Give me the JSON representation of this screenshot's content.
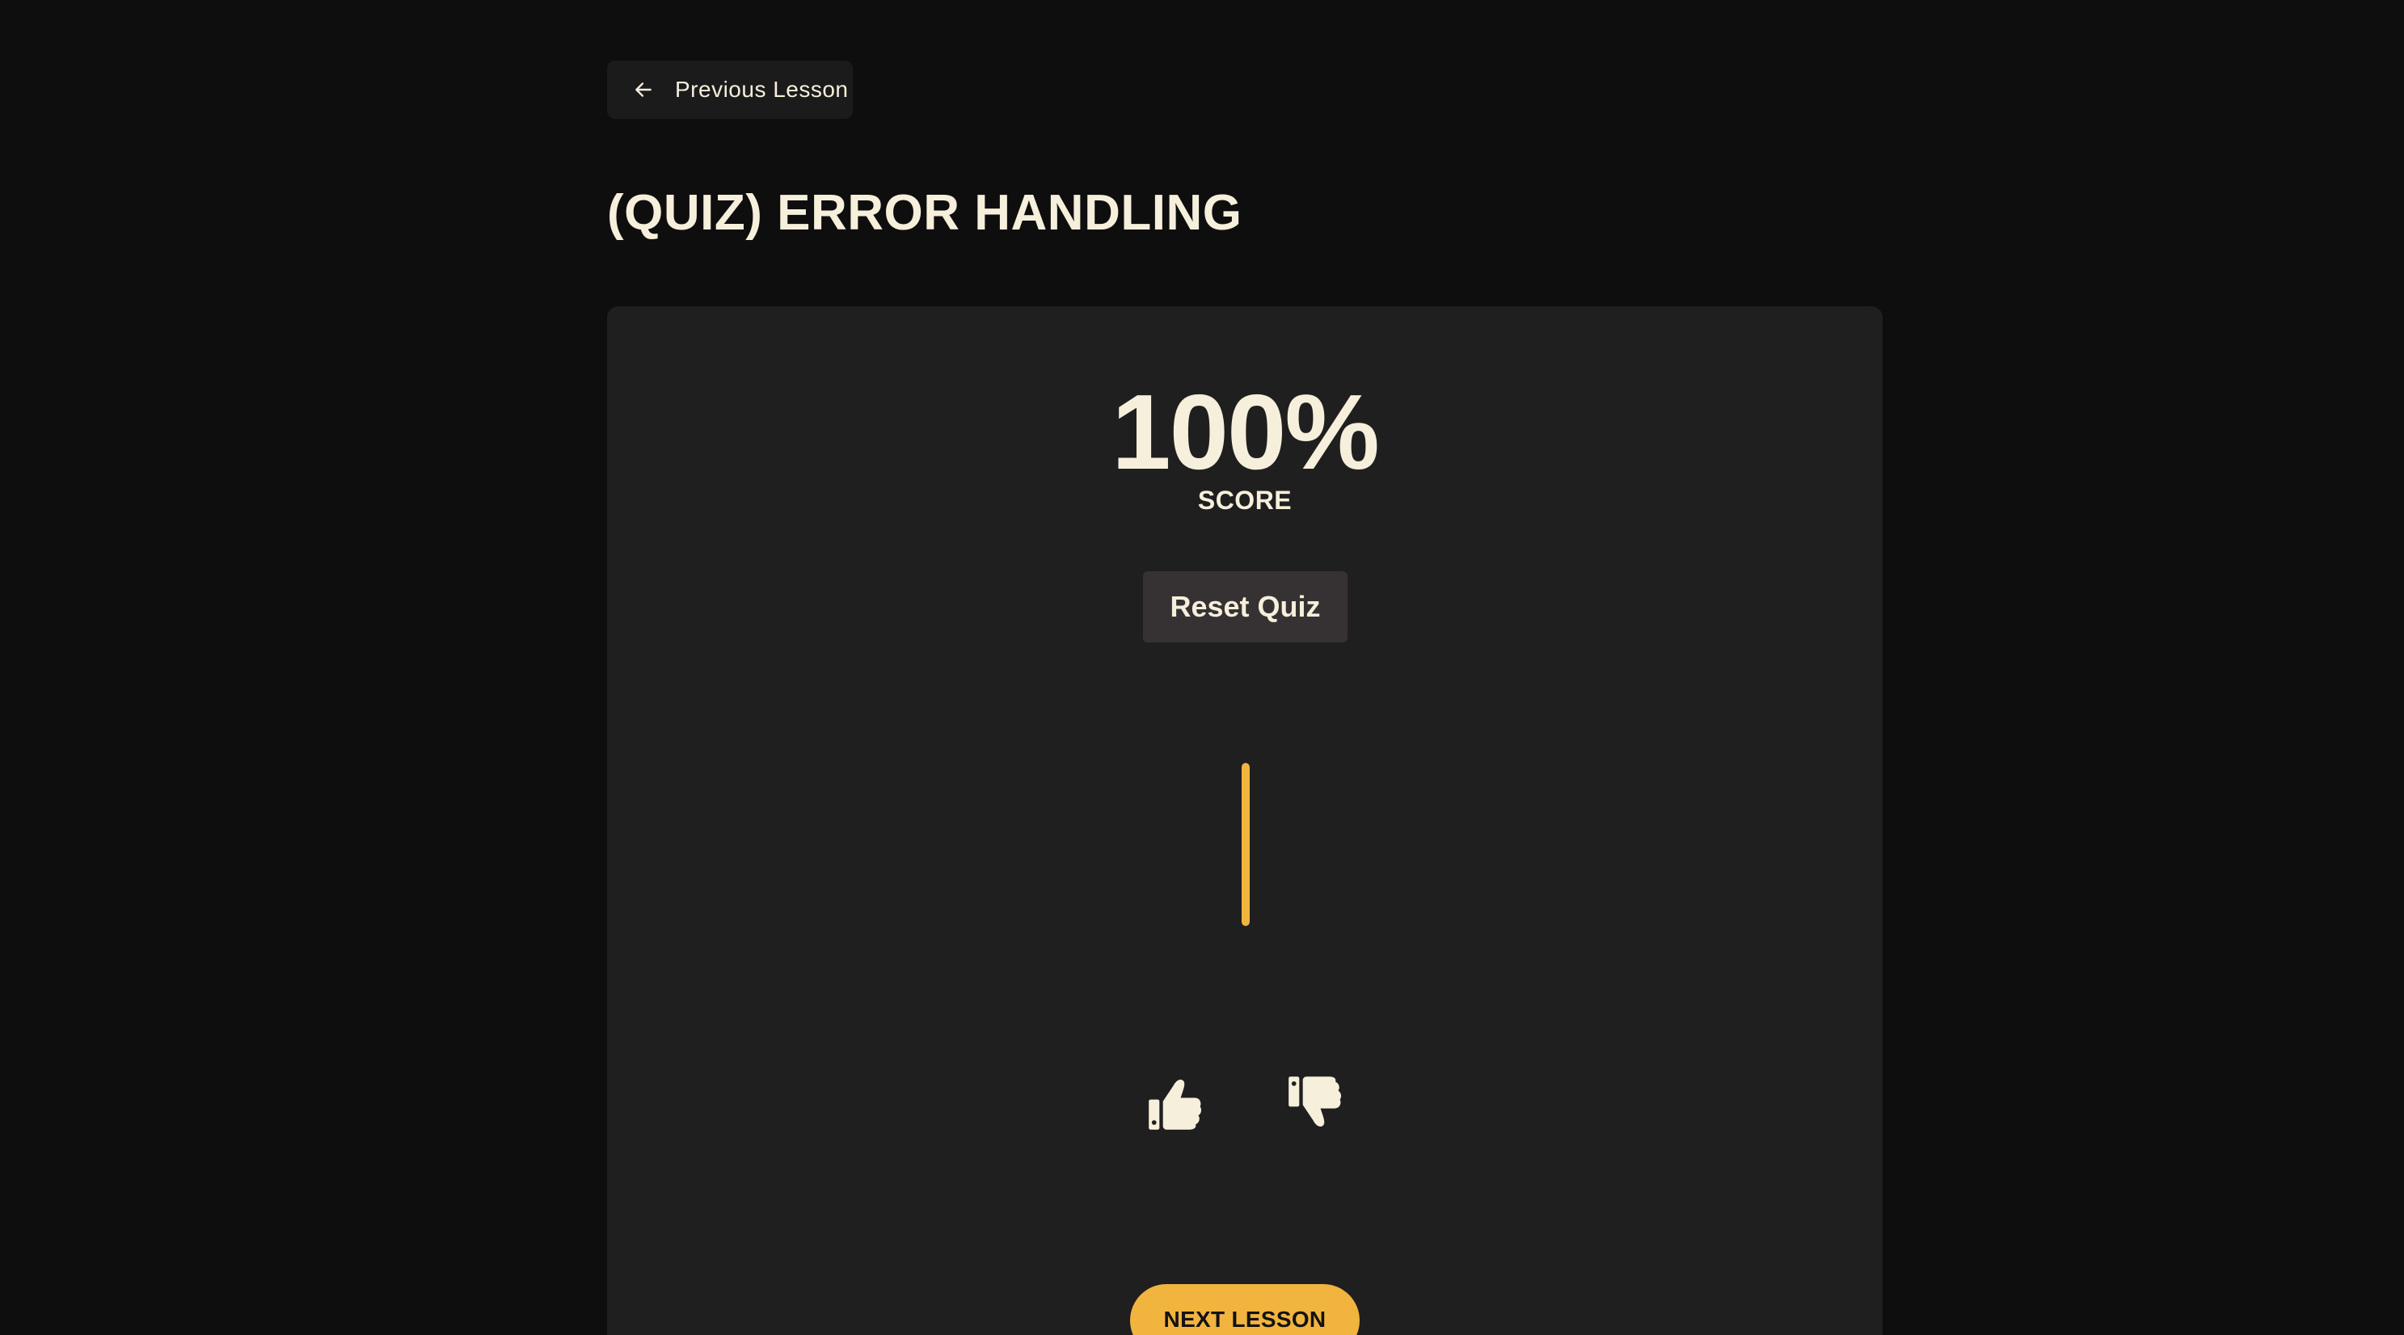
{
  "nav": {
    "previous_label": "Previous Lesson",
    "previous_icon": "arrow-left-icon"
  },
  "lesson": {
    "title": "(QUIZ) ERROR HANDLING"
  },
  "quiz": {
    "score_value": "100%",
    "score_label": "SCORE",
    "reset_label": "Reset Quiz",
    "progress_fraction": 1.0
  },
  "feedback": {
    "thumbs_up_icon": "thumbs-up-icon",
    "thumbs_down_icon": "thumbs-down-icon"
  },
  "footer": {
    "next_label": "NEXT LESSON"
  },
  "colors": {
    "background": "#0f0e0f",
    "card": "#201f20",
    "text": "#f6efdb",
    "accent": "#f1b43f",
    "button_secondary": "#363233"
  }
}
